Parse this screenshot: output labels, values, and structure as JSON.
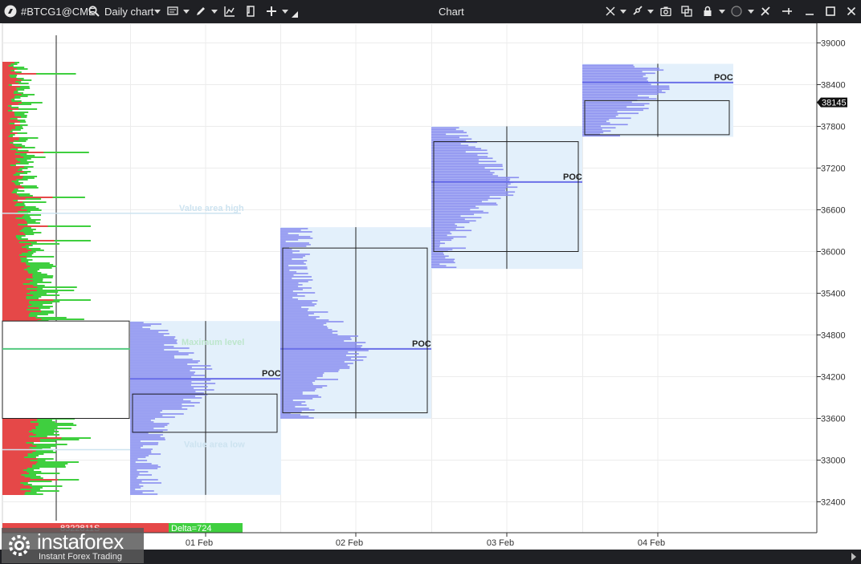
{
  "toolbar": {
    "symbol": "#BTCG1@CME",
    "timeframe": "Daily chart",
    "window_title": "Chart",
    "icons": [
      "app-logo-icon",
      "search-icon",
      "list-icon",
      "pencil-icon",
      "indicator-icon",
      "template-icon",
      "crosshair-icon",
      "magnet-icon",
      "link-icon",
      "camera-icon",
      "copy-icon",
      "lock-icon",
      "circle-icon",
      "tools-icon",
      "pin-icon",
      "minimize-icon",
      "maximize-icon",
      "close-icon"
    ]
  },
  "chart_data": {
    "type": "volume-profile",
    "y_axis": {
      "ticks": [
        39000,
        38400,
        37800,
        37200,
        36600,
        36000,
        35400,
        34800,
        34200,
        33600,
        33000,
        32400
      ],
      "range": [
        32100,
        39100
      ],
      "current_price": "38145"
    },
    "x_axis": {
      "ticks": [
        "01 Feb",
        "02 Feb",
        "03 Feb",
        "04 Feb"
      ]
    },
    "annotations": {
      "value_area_high": "Value area high",
      "maximum_level": "Maximum level",
      "value_area_low": "Value area low",
      "poc": "POC"
    },
    "profiles": [
      {
        "day": "01 Feb",
        "low": 32500,
        "high": 35000,
        "va_low": 33400,
        "va_high": 33950,
        "poc": 34170
      },
      {
        "day": "02 Feb",
        "low": 33600,
        "high": 36350,
        "va_low": 33680,
        "va_high": 36050,
        "poc": 34600
      },
      {
        "day": "03 Feb",
        "low": 35750,
        "high": 37800,
        "va_low": 36000,
        "va_high": 37580,
        "poc": 37000
      },
      {
        "day": "04 Feb",
        "low": 37650,
        "high": 38700,
        "va_low": 37680,
        "va_high": 38170,
        "poc": 38430
      }
    ],
    "left_profile": {
      "box_low": 33600,
      "box_high": 35000,
      "maximum_level": 34600,
      "value_area_high": 36550,
      "value_area_low": 33150
    },
    "footer": {
      "left_text": "8322811S",
      "delta_text": "Delta=724"
    }
  },
  "watermark": {
    "brand": "instaforex",
    "tagline": "Instant Forex Trading"
  },
  "colors": {
    "buy": "#3fcf3f",
    "sell": "#e54848",
    "profile": "#8a8ef0",
    "area": "#e3f0fb",
    "toolbar": "#1f2024"
  }
}
